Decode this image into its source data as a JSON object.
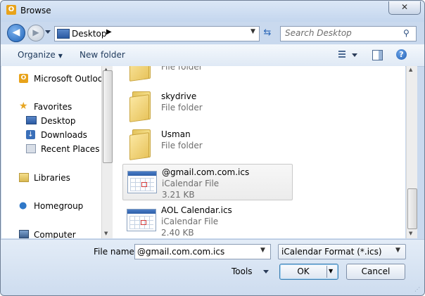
{
  "window": {
    "title": "Browse",
    "app_icon_letter": "O",
    "close_label": "✕"
  },
  "nav": {
    "address": "Desktop",
    "address_chevron": "▶",
    "search_placeholder": "Search Desktop"
  },
  "toolbar": {
    "organize": "Organize",
    "new_folder": "New folder",
    "help": "?"
  },
  "sidebar": {
    "items": [
      {
        "label": "Microsoft Outlook",
        "icon": "outlook-icon"
      },
      {
        "label": "Favorites",
        "icon": "star-icon"
      },
      {
        "label": "Desktop",
        "icon": "desktop-icon"
      },
      {
        "label": "Downloads",
        "icon": "downloads-icon"
      },
      {
        "label": "Recent Places",
        "icon": "recent-places-icon"
      },
      {
        "label": "Libraries",
        "icon": "libraries-icon"
      },
      {
        "label": "Homegroup",
        "icon": "homegroup-icon"
      },
      {
        "label": "Computer",
        "icon": "computer-icon"
      }
    ]
  },
  "files": [
    {
      "name": "",
      "type": "File folder",
      "size": "",
      "icon": "folder-icon"
    },
    {
      "name": "skydrive",
      "type": "File folder",
      "size": "",
      "icon": "folder-icon"
    },
    {
      "name": "Usman",
      "type": "File folder",
      "size": "",
      "icon": "folder-icon"
    },
    {
      "name": "@gmail.com.com.ics",
      "type": "iCalendar File",
      "size": "3.21 KB",
      "icon": "calendar-file-icon"
    },
    {
      "name": "AOL Calendar.ics",
      "type": "iCalendar File",
      "size": "2.40 KB",
      "icon": "calendar-file-icon"
    }
  ],
  "footer": {
    "file_name_label": "File name:",
    "file_name_value": "@gmail.com.com.ics",
    "filter_value": "iCalendar Format (*.ics)",
    "tools_label": "Tools",
    "ok_label": "OK",
    "cancel_label": "Cancel"
  },
  "colors": {
    "frame": "#c9d9ee",
    "accent_blue": "#1e62b8",
    "folder_yellow": "#f6e08b",
    "selection": "#ececec"
  }
}
